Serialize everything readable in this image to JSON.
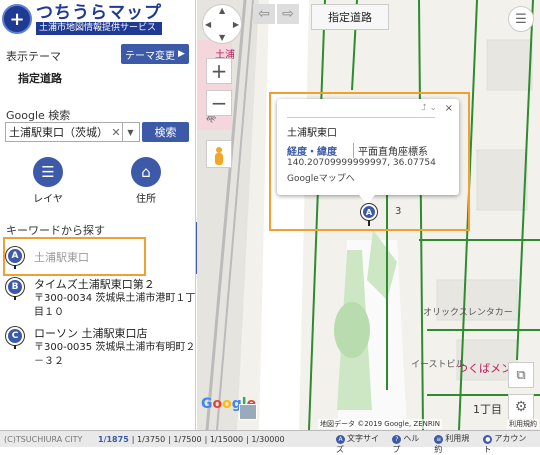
{
  "logo": {
    "title": "つちうらマップ",
    "subtitle": "土浦市地図情報提供サービス",
    "mark": "+"
  },
  "theme": {
    "label": "表示テーマ",
    "button": "テーマ変更",
    "button_icon": "play-icon",
    "value": "指定道路"
  },
  "google_search": {
    "label": "Google 検索",
    "value": "土浦駅東口（茨城）",
    "button": "検索"
  },
  "tools": {
    "layer_label": "レイヤ",
    "address_label": "住所"
  },
  "keyword": {
    "label": "キーワードから探す",
    "results": [
      {
        "pin": "A",
        "name": "土浦駅東口",
        "address": ""
      },
      {
        "pin": "B",
        "name": "タイムズ土浦駅東口第２",
        "address": "〒300-0034 茨城県土浦市港町１丁目１０"
      },
      {
        "pin": "C",
        "name": "ローソン 土浦駅東口店",
        "address": "〒300-0035 茨城県土浦市有明町２－３２"
      }
    ]
  },
  "collapse": "«",
  "map": {
    "road_chip": "指定道路",
    "zoom_in": "+",
    "zoom_out": "−",
    "pin": "A",
    "labels": {
      "station": "土浦",
      "line": "常磐線",
      "num3": "3",
      "rental": "オリックスレンタカー",
      "eto": "イーストビル",
      "tsukuba": "つくばメン",
      "chome": "1丁目"
    },
    "popup": {
      "place": "土浦駅東口",
      "coord_tab": "経度・緯度",
      "coord_alt": "平面直角座標系",
      "coords": "140.20709999999997, 36.07754",
      "gmaps": "Googleマップへ",
      "close": "×",
      "ctl": "⮥ ⌄"
    },
    "google": [
      "G",
      "o",
      "o",
      "g",
      "l",
      "e"
    ]
  },
  "status": {
    "copy": "(C)TSUCHIURA CITY",
    "scales": [
      "1/1875",
      "1/3750",
      "1/7500",
      "1/15000",
      "1/30000"
    ],
    "active_scale": "1/1875",
    "map_data": "地図データ ©2019 Google, ZENRIN",
    "terms": "利用規約",
    "links": [
      "文字サイズ",
      "ヘルプ",
      "利用規約",
      "アカウント"
    ]
  },
  "colors": {
    "accent": "#3d5aa8",
    "highlight": "#f0a030",
    "road": "#2e8b2e"
  }
}
